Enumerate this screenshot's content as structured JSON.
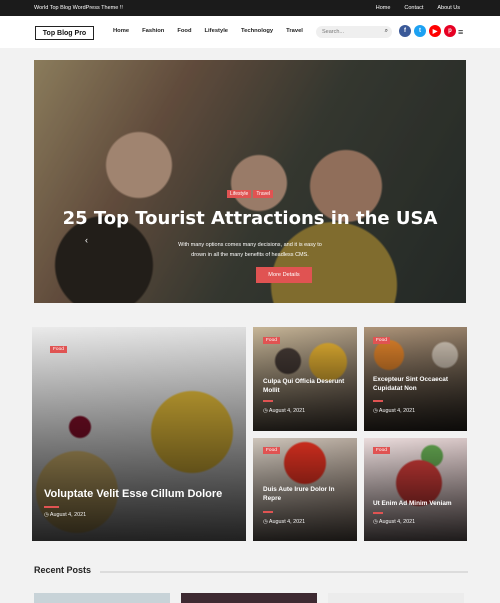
{
  "topbar": {
    "tagline": "World Top Blog WordPress Theme !!",
    "links": [
      "Home",
      "Contact",
      "About Us"
    ]
  },
  "header": {
    "logo": "Top Blog Pro",
    "nav": [
      "Home",
      "Fashion",
      "Food",
      "Lifestyle",
      "Technology",
      "Travel"
    ],
    "search_placeholder": "Search...",
    "social": [
      {
        "icon": "facebook-icon",
        "color": "#3b5998",
        "glyph": "f"
      },
      {
        "icon": "twitter-icon",
        "color": "#1da1f2",
        "glyph": "t"
      },
      {
        "icon": "youtube-icon",
        "color": "#ff0000",
        "glyph": "▶"
      },
      {
        "icon": "pinterest-icon",
        "color": "#e60023",
        "glyph": "p"
      }
    ]
  },
  "hero": {
    "tags": [
      "Lifestyle",
      "Travel"
    ],
    "title": "25 Top Tourist Attractions in the USA",
    "description": "With many options comes many decisions, and it is easy to drown in all the many benefits of headless CMS.",
    "button": "More Details"
  },
  "cards": [
    {
      "category": "Food",
      "title": "Voluptate Velit Esse Cillum Dolore",
      "date": "August 4, 2021"
    },
    {
      "category": "Food",
      "title": "Culpa Qui Officia Deserunt Mollit",
      "date": "August 4, 2021"
    },
    {
      "category": "Food",
      "title": "Excepteur Sint Occaecat Cupidatat Non",
      "date": "August 4, 2021"
    },
    {
      "category": "Food",
      "title": "Duis Aute Irure Dolor In Repre",
      "date": "August 4, 2021"
    },
    {
      "category": "Food",
      "title": "Ut Enim Ad Minim Veniam",
      "date": "August 4, 2021"
    }
  ],
  "recent": {
    "title": "Recent Posts"
  },
  "colors": {
    "accent": "#e05352",
    "topbar": "#1b1b1b"
  }
}
